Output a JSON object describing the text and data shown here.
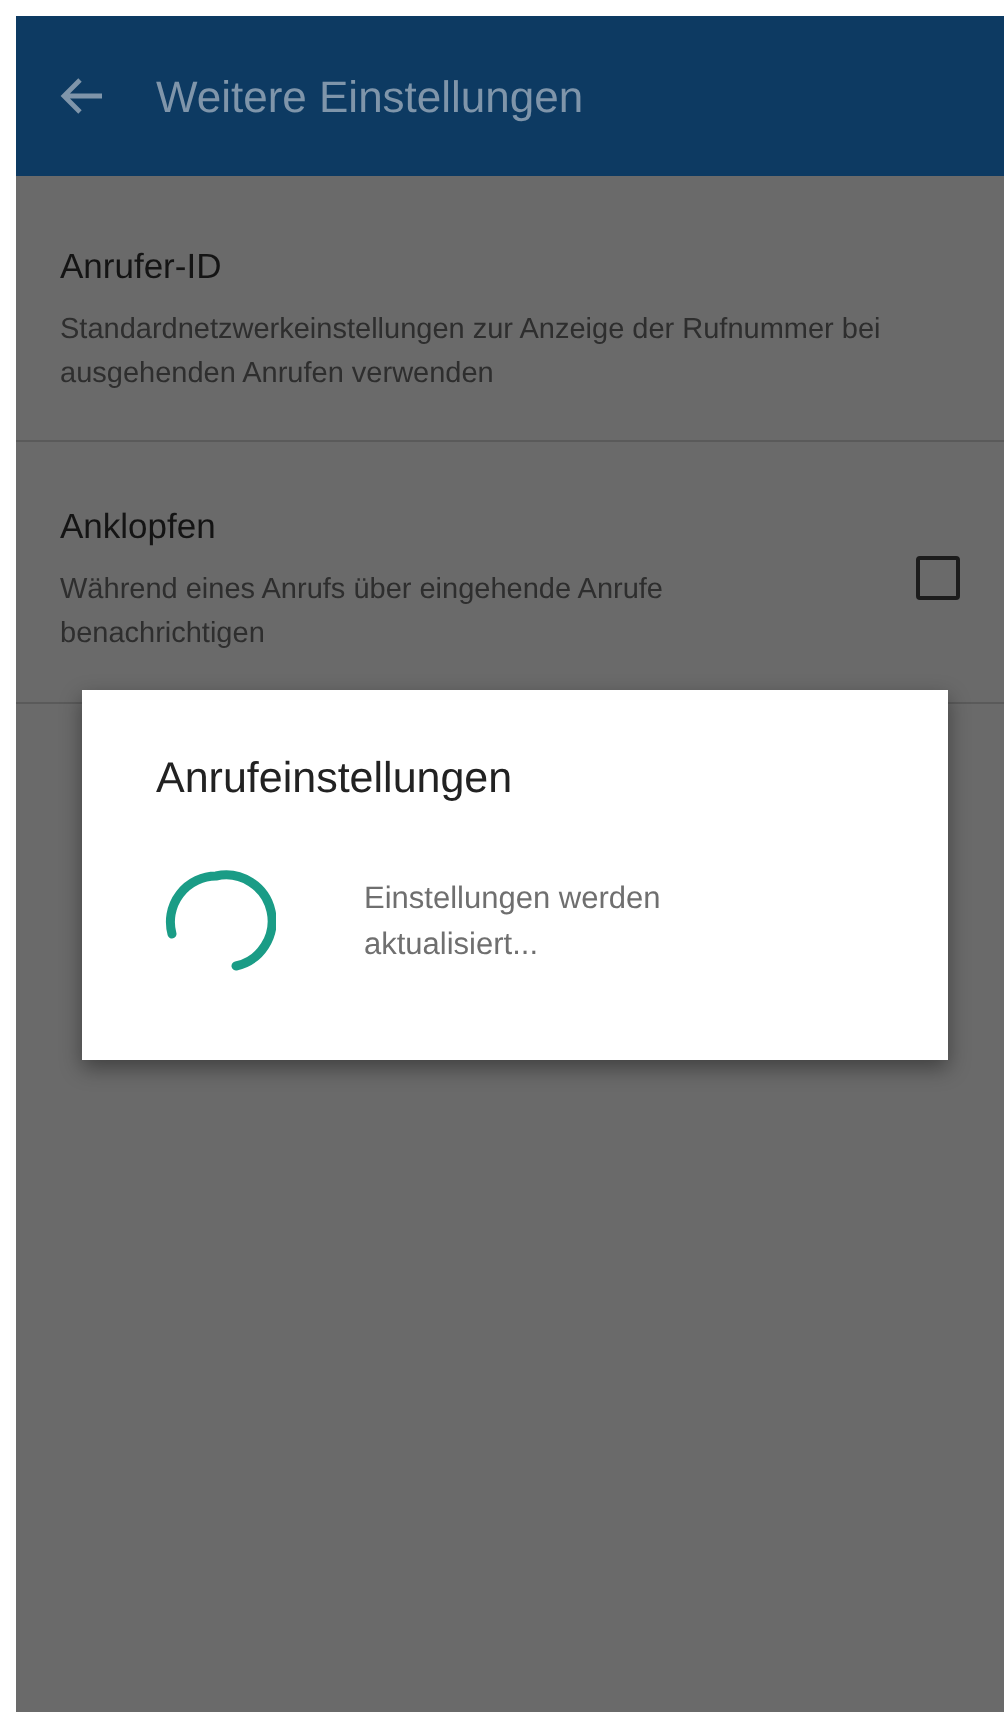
{
  "app_bar": {
    "title": "Weitere Einstellungen"
  },
  "settings": [
    {
      "kind": "text",
      "title": "Anrufer-ID",
      "summary": "Standardnetzwerkeinstellungen zur Anzeige der Rufnummer bei ausgehenden Anrufen verwenden"
    },
    {
      "kind": "checkbox",
      "title": "Anklopfen",
      "summary": "Während eines Anrufs über eingehende Anrufe benachrichtigen",
      "checked": false
    }
  ],
  "dialog": {
    "title": "Anrufeinstellungen",
    "message": "Einstellungen werden aktualisiert..."
  }
}
